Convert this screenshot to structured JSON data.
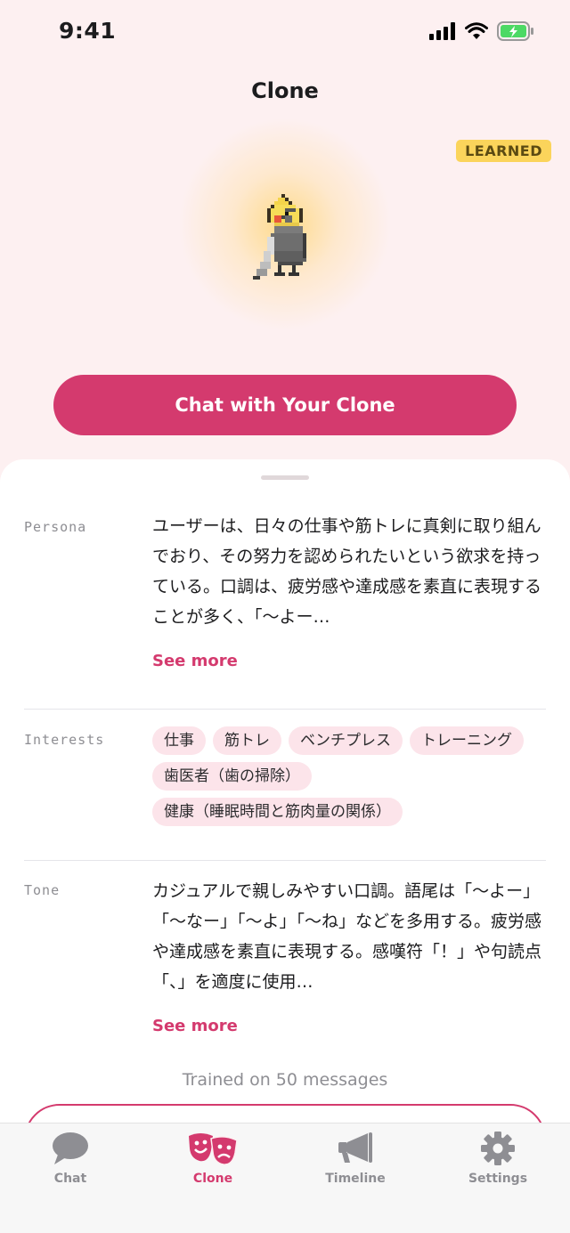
{
  "status_bar": {
    "time": "9:41"
  },
  "header": {
    "title": "Clone",
    "badge": "LEARNED"
  },
  "cta": {
    "label": "Chat with Your Clone"
  },
  "persona": {
    "label": "Persona",
    "text": "ユーザーは、日々の仕事や筋トレに真剣に取り組んでおり、その努力を認められたいという欲求を持っている。口調は、疲労感や達成感を素直に表現することが多く、「〜よー…",
    "see_more": "See more"
  },
  "interests": {
    "label": "Interests",
    "chips": [
      "仕事",
      "筋トレ",
      "ベンチプレス",
      "トレーニング",
      "歯医者（歯の掃除）",
      "健康（睡眠時間と筋肉量の関係）"
    ]
  },
  "tone": {
    "label": "Tone",
    "text": "カジュアルで親しみやすい口調。語尾は「〜よー」「〜なー」「〜よ」「〜ね」などを多用する。疲労感や達成感を素直に表現する。感嘆符「！」や句読点「、」を適度に使用…",
    "see_more": "See more"
  },
  "footer": {
    "trained_text": "Trained on 50 messages"
  },
  "tab_bar": {
    "items": [
      {
        "label": "Chat",
        "icon": "chat-bubble-icon"
      },
      {
        "label": "Clone",
        "icon": "theater-masks-icon",
        "active": true
      },
      {
        "label": "Timeline",
        "icon": "megaphone-icon"
      },
      {
        "label": "Settings",
        "icon": "gear-icon"
      }
    ]
  },
  "colors": {
    "accent": "#d43a6e",
    "background": "#fdf0f1",
    "badge": "#fbd45b",
    "chip": "#fce4ea"
  }
}
